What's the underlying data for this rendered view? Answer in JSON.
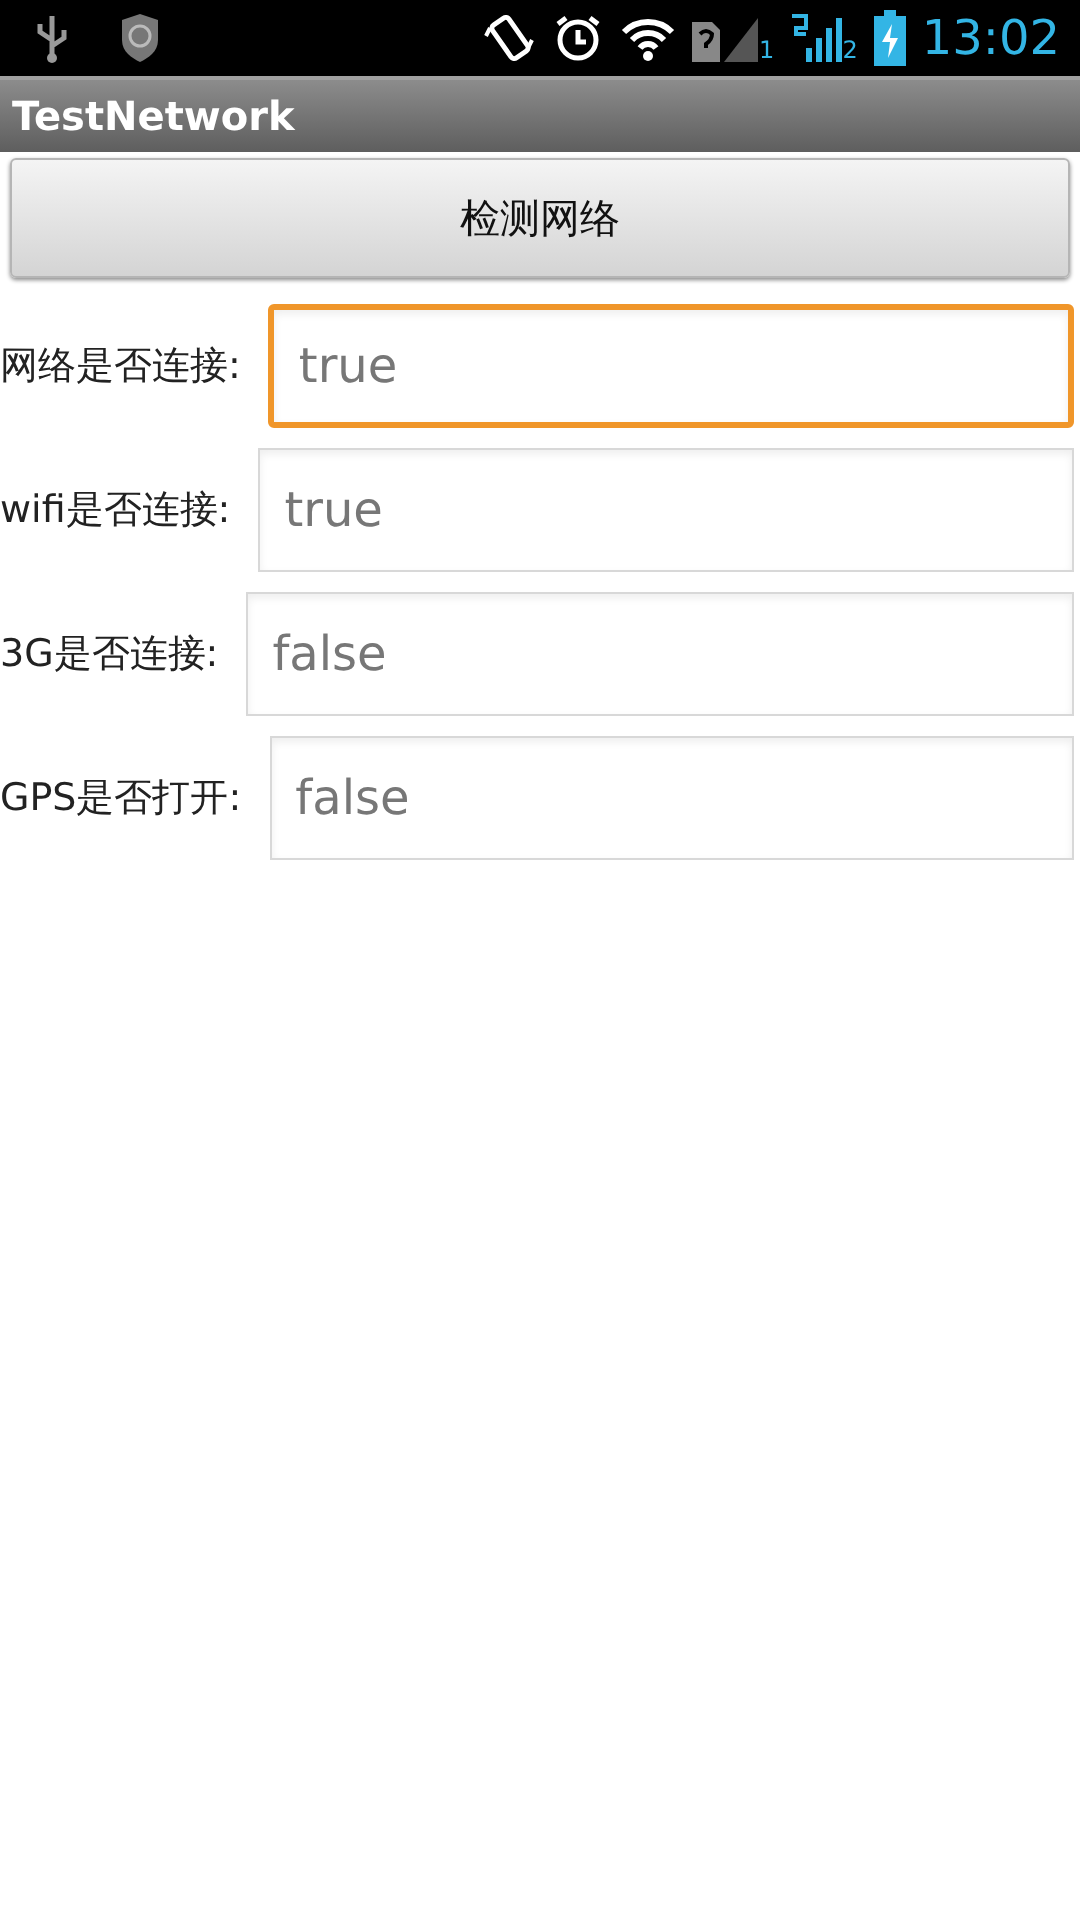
{
  "status_bar": {
    "time": "13:02",
    "sim_slot_label": "1",
    "signal_slot_label": "2"
  },
  "app_bar": {
    "title": "TestNetwork"
  },
  "check_button": {
    "label": "检测网络"
  },
  "rows": [
    {
      "label": "网络是否连接:",
      "value": "true",
      "focused": true
    },
    {
      "label": "wifi是否连接:",
      "value": "true",
      "focused": false
    },
    {
      "label": "3G是否连接:",
      "value": "false",
      "focused": false
    },
    {
      "label": "GPS是否打开:",
      "value": "false",
      "focused": false
    }
  ]
}
